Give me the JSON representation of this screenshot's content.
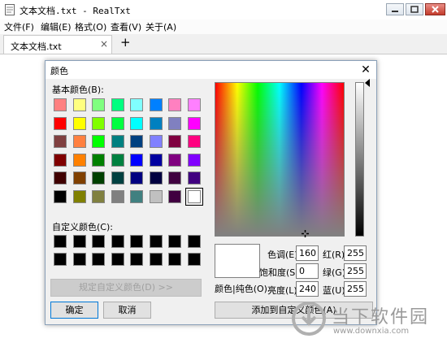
{
  "window": {
    "title": "文本文档.txt - RealTxt"
  },
  "menu": [
    "文件(F)",
    "编辑(E)",
    "格式(O)",
    "查看(V)",
    "关于(A)"
  ],
  "tab": {
    "label": "文本文档.txt",
    "close": "×",
    "add": "+"
  },
  "dialog": {
    "title": "颜色",
    "close": "✕",
    "basic_label": "基本颜色(B):",
    "custom_label": "自定义颜色(C):",
    "define_custom_label": "规定自定义颜色(D) >>",
    "ok_label": "确定",
    "cancel_label": "取消",
    "preview_label": "颜色|纯色(O)",
    "add_custom_label": "添加到自定义颜色(A)",
    "fields": {
      "hue": {
        "label": "色调(E):",
        "value": "160"
      },
      "sat": {
        "label": "饱和度(S):",
        "value": "0"
      },
      "lum": {
        "label": "亮度(L):",
        "value": "240"
      },
      "red": {
        "label": "红(R):",
        "value": "255"
      },
      "green": {
        "label": "绿(G):",
        "value": "255"
      },
      "blue": {
        "label": "蓝(U):",
        "value": "255"
      }
    },
    "basic_colors": [
      [
        "#ff8080",
        "#ffff80",
        "#80ff80",
        "#00ff80",
        "#80ffff",
        "#0080ff",
        "#ff80c0",
        "#ff80ff"
      ],
      [
        "#ff0000",
        "#ffff00",
        "#80ff00",
        "#00ff40",
        "#00ffff",
        "#0080c0",
        "#8080c0",
        "#ff00ff"
      ],
      [
        "#804040",
        "#ff8040",
        "#00ff00",
        "#008080",
        "#004080",
        "#8080ff",
        "#800040",
        "#ff0080"
      ],
      [
        "#800000",
        "#ff8000",
        "#008000",
        "#008040",
        "#0000ff",
        "#0000a0",
        "#800080",
        "#8000ff"
      ],
      [
        "#400000",
        "#804000",
        "#004000",
        "#004040",
        "#000080",
        "#000040",
        "#400040",
        "#400080"
      ],
      [
        "#000000",
        "#808000",
        "#808040",
        "#808080",
        "#408080",
        "#c0c0c0",
        "#400040",
        "#ffffff"
      ]
    ],
    "selected_swatch": {
      "row": 5,
      "col": 7
    },
    "custom_colors": [
      [
        "#000000",
        "#000000",
        "#000000",
        "#000000",
        "#000000",
        "#000000",
        "#000000",
        "#000000"
      ],
      [
        "#000000",
        "#000000",
        "#000000",
        "#000000",
        "#000000",
        "#000000",
        "#000000",
        "#000000"
      ]
    ]
  },
  "watermark": {
    "text": "当下软件园",
    "url": "www.downxia.com"
  }
}
